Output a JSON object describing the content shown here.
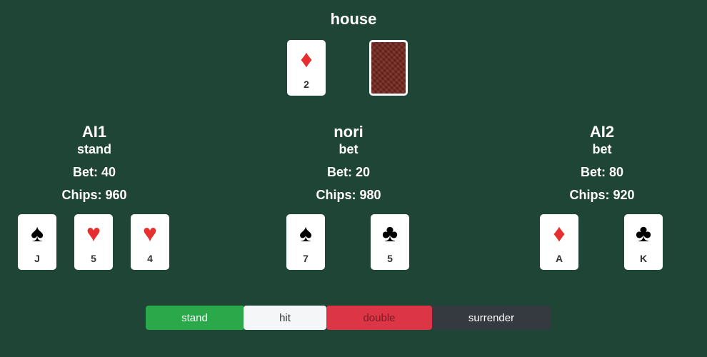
{
  "house": {
    "name": "house",
    "cards": [
      {
        "suit": "diamond",
        "symbol": "♦",
        "rank": "2",
        "color": "#e63030"
      },
      {
        "face_down": true
      }
    ]
  },
  "players": [
    {
      "name": "AI1",
      "status": "stand",
      "bet": "Bet: 40",
      "chips": "Chips: 960",
      "cards": [
        {
          "suit": "spade",
          "symbol": "♠",
          "rank": "J"
        },
        {
          "suit": "heart",
          "symbol": "♥",
          "rank": "5"
        },
        {
          "suit": "heart",
          "symbol": "♥",
          "rank": "4"
        }
      ]
    },
    {
      "name": "nori",
      "status": "bet",
      "bet": "Bet: 20",
      "chips": "Chips: 980",
      "cards": [
        {
          "suit": "spade",
          "symbol": "♠",
          "rank": "7"
        },
        {
          "suit": "club",
          "symbol": "♣",
          "rank": "5"
        }
      ]
    },
    {
      "name": "AI2",
      "status": "bet",
      "bet": "Bet: 80",
      "chips": "Chips: 920",
      "cards": [
        {
          "suit": "diamond",
          "symbol": "♦",
          "rank": "A"
        },
        {
          "suit": "club",
          "symbol": "♣",
          "rank": "K"
        }
      ]
    }
  ],
  "actions": {
    "stand": "stand",
    "hit": "hit",
    "double": "double",
    "surrender": "surrender"
  },
  "colors": {
    "table": "#1f4536",
    "red_suit": "#e63030",
    "stand": "#2aa84a",
    "hit": "#f5f6f7",
    "double": "#dc3545",
    "surrender": "#343a40"
  }
}
